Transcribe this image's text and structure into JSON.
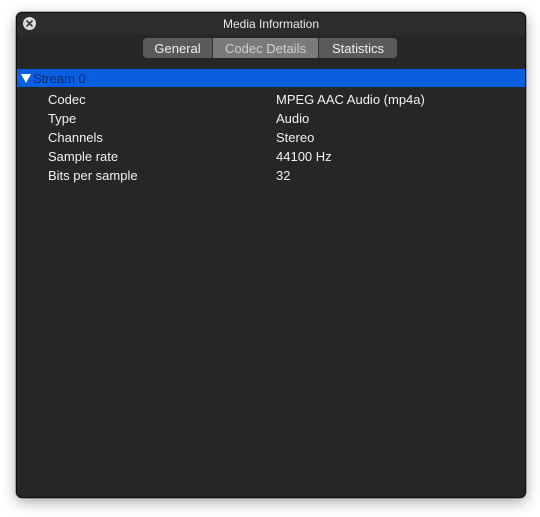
{
  "window": {
    "title": "Media Information"
  },
  "tabs": [
    {
      "label": "General",
      "active": false
    },
    {
      "label": "Codec Details",
      "active": true
    },
    {
      "label": "Statistics",
      "active": false
    }
  ],
  "stream": {
    "label": "Stream 0",
    "expanded": true,
    "rows": [
      {
        "key": "Codec",
        "value": "MPEG AAC Audio (mp4a)"
      },
      {
        "key": "Type",
        "value": "Audio"
      },
      {
        "key": "Channels",
        "value": "Stereo"
      },
      {
        "key": "Sample rate",
        "value": "44100 Hz"
      },
      {
        "key": "Bits per sample",
        "value": "32"
      }
    ]
  },
  "colors": {
    "selection": "#0a5fe0",
    "background": "#262626",
    "text": "#f2f2f2"
  },
  "icons": {
    "close": "close-icon",
    "disclosure": "disclosure-triangle-down-icon"
  }
}
